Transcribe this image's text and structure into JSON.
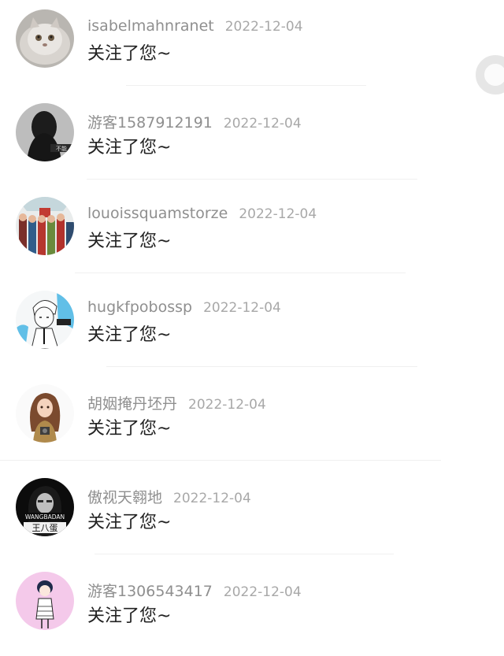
{
  "notifications": [
    {
      "username": "isabelmahnranet",
      "date": "2022-12-04",
      "message": "关注了您~",
      "avatar": "persian-cat-photo"
    },
    {
      "username": "游客1587912191",
      "date": "2022-12-04",
      "message": "关注了您~",
      "avatar": "dark-hair-girl-photo"
    },
    {
      "username": "louoissquamstorze",
      "date": "2022-12-04",
      "message": "关注了您~",
      "avatar": "toy-soldiers-illustration"
    },
    {
      "username": "hugkfpobossp",
      "date": "2022-12-04",
      "message": "关注了您~",
      "avatar": "anime-boy-drawing"
    },
    {
      "username": "胡姻掩丹坯丹",
      "date": "2022-12-04",
      "message": "关注了您~",
      "avatar": "long-hair-girl-illustration"
    },
    {
      "username": "傲视天翱地",
      "date": "2022-12-04",
      "message": "关注了您~",
      "avatar": "wangbadan-girl-photo"
    },
    {
      "username": "游客1306543417",
      "date": "2022-12-04",
      "message": "关注了您~",
      "avatar": "bob-hair-girl-illustration"
    }
  ],
  "avatar_texts": {
    "avatar_2_caption": "不能",
    "avatar_6_top": "WANGBADAN",
    "avatar_6_bottom": "王八蛋"
  },
  "side_control": {
    "icon": "circle-ring-icon"
  }
}
